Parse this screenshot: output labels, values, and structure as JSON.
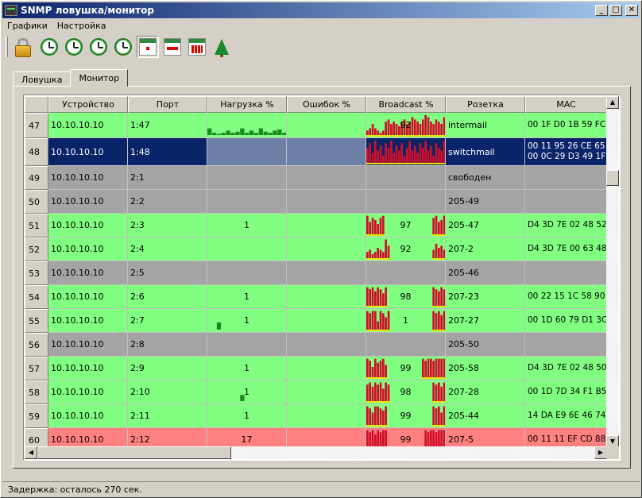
{
  "window": {
    "title": "SNMP ловушка/монитор",
    "controls": {
      "minimize": "_",
      "maximize": "□",
      "close": "✕"
    }
  },
  "menu": [
    "Графики",
    "Настройка"
  ],
  "toolbar": [
    {
      "name": "lock-icon",
      "pressed": false
    },
    {
      "name": "clock-icon",
      "pressed": false
    },
    {
      "name": "clock-icon",
      "pressed": false
    },
    {
      "name": "clock-icon",
      "pressed": false
    },
    {
      "name": "clock-icon",
      "pressed": false
    },
    {
      "name": "calendar-day-icon",
      "pressed": true
    },
    {
      "name": "calendar-week-icon",
      "pressed": false
    },
    {
      "name": "calendar-month-icon",
      "pressed": false
    },
    {
      "name": "tree-icon",
      "pressed": false
    }
  ],
  "tabs": [
    {
      "label": "Ловушка",
      "active": false
    },
    {
      "label": "Монитор",
      "active": true
    }
  ],
  "columns": [
    "",
    "Устройство",
    "Порт",
    "Нагрузка %",
    "Ошибок %",
    "Broadcast %",
    "Розетка",
    "MAC"
  ],
  "rows": [
    {
      "num": "47",
      "device": "10.10.10.10",
      "port": "1:47",
      "load": "",
      "errors": "",
      "broadcast": "92",
      "socket": "intermail",
      "mac": [
        "00 1F D0 1B 59 FC"
      ],
      "status": "green",
      "load_spark": [
        0.3,
        0.1,
        0.05,
        0.1,
        0.2,
        0.1,
        0.15,
        0.3,
        0.1,
        0.2,
        0.1,
        0.3,
        0.15,
        0.1,
        0.2,
        0.25,
        0.1
      ],
      "bc_spark": [
        0.2,
        0.3,
        0.5,
        0.3,
        0.2,
        0.1,
        0.2,
        0.6,
        0.7,
        0.5,
        0.6,
        0.5,
        0.4,
        0.6,
        0.7,
        0.5,
        0.6,
        0.8,
        0.7,
        0.6,
        0.5,
        0.7,
        0.9,
        0.8,
        0.6,
        0.5,
        0.7,
        0.6,
        0.5,
        0.8
      ]
    },
    {
      "num": "48",
      "device": "10.10.10.10",
      "port": "1:48",
      "load": "",
      "errors": "",
      "broadcast": "",
      "socket": "switchmail",
      "mac": [
        "00 11 95 26 CE 65",
        "00 0C 29 D3 49 1F"
      ],
      "status": "selected",
      "load_spark": [],
      "bc_spark": [
        0.6,
        0.8,
        0.4,
        0.9,
        0.5,
        0.7,
        0.3,
        0.8,
        0.6,
        0.9,
        0.4,
        0.7,
        0.5,
        0.8,
        0.3,
        0.6,
        0.9,
        0.5,
        0.7,
        0.4,
        0.8,
        0.6,
        0.9,
        0.5,
        0.7,
        0.3,
        0.8,
        0.6,
        0.5,
        0.9
      ]
    },
    {
      "num": "49",
      "device": "10.10.10.10",
      "port": "2:1",
      "load": "",
      "errors": "",
      "broadcast": "",
      "socket": "свободен",
      "mac": [
        ""
      ],
      "status": "gray",
      "load_spark": [],
      "bc_spark": []
    },
    {
      "num": "50",
      "device": "10.10.10.10",
      "port": "2:2",
      "load": "",
      "errors": "",
      "broadcast": "",
      "socket": "205-49",
      "mac": [
        ""
      ],
      "status": "gray",
      "load_spark": [],
      "bc_spark": []
    },
    {
      "num": "51",
      "device": "10.10.10.10",
      "port": "2:3",
      "load": "1",
      "errors": "",
      "broadcast": "97",
      "socket": "205-47",
      "mac": [
        "D4 3D 7E 02 48 52"
      ],
      "status": "green",
      "load_spark": [],
      "bc_spark": [
        0.9,
        0.6,
        0.8,
        0.7,
        0.5,
        0.8,
        0.9,
        0,
        0,
        0,
        0,
        0,
        0,
        0,
        0,
        0,
        0,
        0,
        0,
        0,
        0,
        0,
        0,
        0,
        0,
        0.8,
        0.9,
        0.6,
        0.7,
        0.9
      ]
    },
    {
      "num": "52",
      "device": "10.10.10.10",
      "port": "2:4",
      "load": "",
      "errors": "",
      "broadcast": "92",
      "socket": "207-2",
      "mac": [
        "D4 3D 7E 00 63 48"
      ],
      "status": "green",
      "load_spark": [],
      "bc_spark": [
        0.3,
        0.4,
        0.2,
        0.3,
        0.5,
        0.4,
        0.3,
        0.9,
        0.6,
        0,
        0,
        0,
        0,
        0,
        0,
        0,
        0,
        0,
        0,
        0,
        0,
        0,
        0,
        0,
        0,
        0.4,
        0.7,
        0.5,
        0.6,
        0.4
      ]
    },
    {
      "num": "53",
      "device": "10.10.10.10",
      "port": "2:5",
      "load": "",
      "errors": "",
      "broadcast": "",
      "socket": "205-46",
      "mac": [
        ""
      ],
      "status": "gray",
      "load_spark": [],
      "bc_spark": []
    },
    {
      "num": "54",
      "device": "10.10.10.10",
      "port": "2:6",
      "load": "1",
      "errors": "",
      "broadcast": "98",
      "socket": "207-23",
      "mac": [
        "00 22 15 1C 58 90"
      ],
      "status": "green",
      "load_spark": [],
      "bc_spark": [
        0.9,
        0.8,
        0.9,
        0.7,
        0.9,
        0.8,
        0.6,
        0.9,
        0,
        0,
        0,
        0,
        0,
        0,
        0,
        0,
        0,
        0,
        0,
        0,
        0,
        0,
        0,
        0,
        0,
        0.9,
        0.8,
        0.7,
        0.9,
        0.8
      ]
    },
    {
      "num": "55",
      "device": "10.10.10.10",
      "port": "2:7",
      "load": "1",
      "errors": "",
      "broadcast": "1",
      "socket": "207-27",
      "mac": [
        "00 1D 60 79 D1 3C"
      ],
      "status": "green",
      "load_spark": [
        0,
        0,
        0.35,
        0,
        0,
        0,
        0,
        0,
        0,
        0,
        0,
        0,
        0,
        0,
        0,
        0,
        0
      ],
      "bc_spark": [
        0.9,
        0.8,
        0.9,
        0.9,
        0.4,
        0.9,
        0.8,
        0.6,
        0.9,
        0,
        0,
        0,
        0,
        0,
        0,
        0,
        0,
        0,
        0,
        0,
        0,
        0,
        0,
        0,
        0,
        0.9,
        0.8,
        0.9,
        0.7,
        0.9
      ]
    },
    {
      "num": "56",
      "device": "10.10.10.10",
      "port": "2:8",
      "load": "",
      "errors": "",
      "broadcast": "",
      "socket": "205-50",
      "mac": [
        ""
      ],
      "status": "gray",
      "load_spark": [],
      "bc_spark": []
    },
    {
      "num": "57",
      "device": "10.10.10.10",
      "port": "2:9",
      "load": "1",
      "errors": "",
      "broadcast": "99",
      "socket": "205-58",
      "mac": [
        "D4 3D 7E 02 48 50"
      ],
      "status": "green",
      "load_spark": [],
      "bc_spark": [
        0.9,
        0.8,
        0.5,
        0.9,
        0.7,
        0.8,
        0.9,
        0.6,
        0,
        0,
        0,
        0,
        0,
        0,
        0,
        0,
        0,
        0,
        0,
        0,
        0,
        0.9,
        0.8,
        0.9,
        0.9,
        0.8,
        0.9,
        0.9,
        0.9,
        0.9
      ]
    },
    {
      "num": "58",
      "device": "10.10.10.10",
      "port": "2:10",
      "load": "1",
      "errors": "",
      "broadcast": "98",
      "socket": "207-28",
      "mac": [
        "00 1D 7D 34 F1 B5"
      ],
      "status": "green",
      "load_spark": [
        0,
        0,
        0,
        0,
        0,
        0,
        0,
        0.3,
        0,
        0,
        0,
        0,
        0,
        0,
        0,
        0,
        0
      ],
      "bc_spark": [
        0.8,
        0.9,
        0.7,
        0.9,
        0.8,
        0.9,
        0.6,
        0.9,
        0.8,
        0,
        0,
        0,
        0,
        0,
        0,
        0,
        0,
        0,
        0,
        0,
        0,
        0,
        0,
        0,
        0,
        0.9,
        0.8,
        0.9,
        0.7,
        0.9
      ]
    },
    {
      "num": "59",
      "device": "10.10.10.10",
      "port": "2:11",
      "load": "1",
      "errors": "",
      "broadcast": "99",
      "socket": "205-44",
      "mac": [
        "14 DA E9 6E 46 74"
      ],
      "status": "green",
      "load_spark": [],
      "bc_spark": [
        0.9,
        0.8,
        0.6,
        0.9,
        0.9,
        0.8,
        0.7,
        0.9,
        0,
        0,
        0,
        0,
        0,
        0,
        0,
        0,
        0,
        0,
        0,
        0,
        0,
        0,
        0,
        0,
        0,
        0.9,
        0.8,
        0.9,
        0.6,
        0.9
      ]
    },
    {
      "num": "60",
      "device": "10.10.10.10",
      "port": "2:12",
      "load": "17",
      "errors": "",
      "broadcast": "99",
      "socket": "207-5",
      "mac": [
        "00 11 11 EF CD 88"
      ],
      "status": "red",
      "load_spark": [],
      "bc_spark": [
        0.9,
        0.8,
        0.9,
        0.7,
        0.9,
        0.8,
        0.9,
        0.9,
        0,
        0,
        0,
        0,
        0,
        0,
        0,
        0,
        0,
        0,
        0,
        0,
        0,
        0,
        0.9,
        0.8,
        0.9,
        0.9,
        0.8,
        0.9,
        0.9,
        0.9
      ]
    }
  ],
  "colors": {
    "ok": "#80ff80",
    "inactive": "#a4a4a4",
    "alarm": "#ff8080",
    "selected": "#0a246a",
    "broadcast_bar": "#d0102a",
    "load_bar": "#1a8a1a",
    "baseline": "#e8e800"
  },
  "status": {
    "text": "Задержка: осталось 270 сек."
  }
}
